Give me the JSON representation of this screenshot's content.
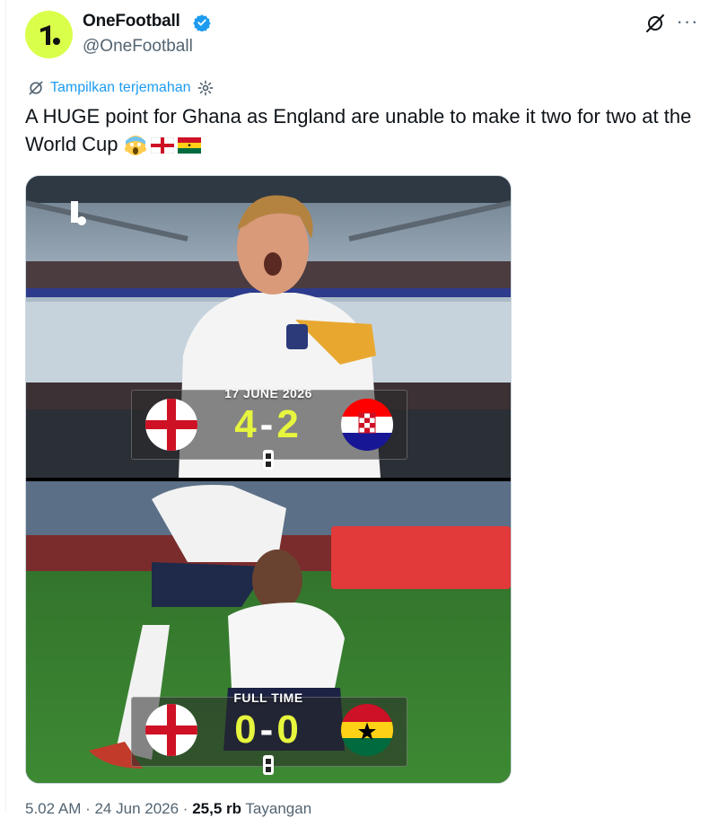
{
  "author": {
    "name": "OneFootball",
    "handle": "@OneFootball",
    "verified": true,
    "avatar_icon": "onefootball-logo-icon",
    "avatar_color": "#d9ff4a"
  },
  "translate": {
    "label": "Tampilkan terjemahan"
  },
  "tweet": {
    "text": "A HUGE point for Ghana as England are unable to make it two for two at the World Cup",
    "emojis": [
      "scream-emoji",
      "england-flag-emoji",
      "ghana-flag-emoji"
    ]
  },
  "matches": [
    {
      "header": "17 JUNE 2026",
      "home_score": "4",
      "separator": "-",
      "away_score": "2",
      "home_team_flag": "england-flag",
      "away_team_flag": "croatia-flag"
    },
    {
      "header": "FULL TIME",
      "home_score": "0",
      "separator": "-",
      "away_score": "0",
      "home_team_flag": "england-flag",
      "away_team_flag": "ghana-flag"
    }
  ],
  "meta": {
    "time_date": "5.02 AM · 24 Jun 2026 ·",
    "views_count": "25,5 rb",
    "views_label": "Tayangan"
  },
  "colors": {
    "link": "#1d9bf0",
    "score": "#e6f53d",
    "secondary_text": "#536471"
  }
}
